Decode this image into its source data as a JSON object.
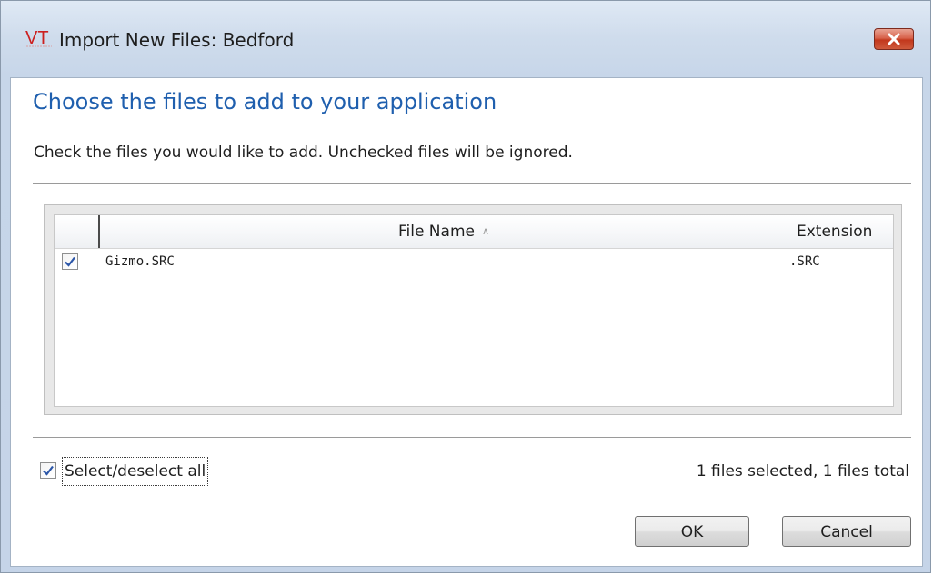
{
  "window": {
    "title": "Import New Files: Bedford",
    "logo_text": "VT"
  },
  "dialog": {
    "heading": "Choose the files to add to your application",
    "instruction": "Check the files you would like to add. Unchecked files will be ignored."
  },
  "list": {
    "columns": [
      {
        "label": "File Name",
        "sorted": "ascending"
      },
      {
        "label": "Extension"
      }
    ],
    "rows": [
      {
        "checked": true,
        "file_name": "Gizmo.SRC",
        "extension": ".SRC"
      }
    ]
  },
  "footer": {
    "select_all_label": "Select/deselect all",
    "select_all_checked": true,
    "status": "1 files selected, 1 files total"
  },
  "buttons": {
    "ok": "OK",
    "cancel": "Cancel"
  },
  "colors": {
    "heading": "#1f5fae",
    "close_button": "#c2381d",
    "checkmark": "#2b56a8"
  }
}
